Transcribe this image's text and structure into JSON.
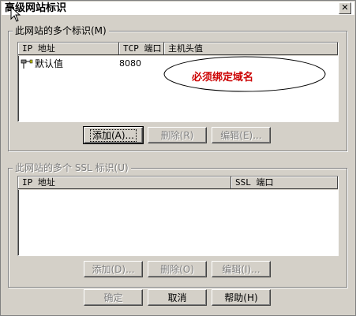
{
  "title": "高级网站标识",
  "close_glyph": "✕",
  "group1": {
    "label": "此网站的多个标识(M)",
    "columns": [
      "IP 地址",
      "TCP 端口",
      "主机头值"
    ],
    "rows": [
      {
        "ip": "默认值",
        "port": "8080",
        "host": ""
      }
    ],
    "annotation": "必须绑定域名",
    "annotation_color": "#cc0000",
    "buttons": {
      "add": "添加(A)...",
      "remove": "删除(R)",
      "edit": "编辑(E)..."
    }
  },
  "group2": {
    "label": "此网站的多个 SSL 标识(U)",
    "columns": [
      "IP 地址",
      "SSL 端口"
    ],
    "buttons": {
      "add": "添加(D)...",
      "remove": "删除(O)",
      "edit": "编辑(I)..."
    }
  },
  "footer": {
    "ok": "确定",
    "cancel": "取消",
    "help": "帮助(H)"
  }
}
